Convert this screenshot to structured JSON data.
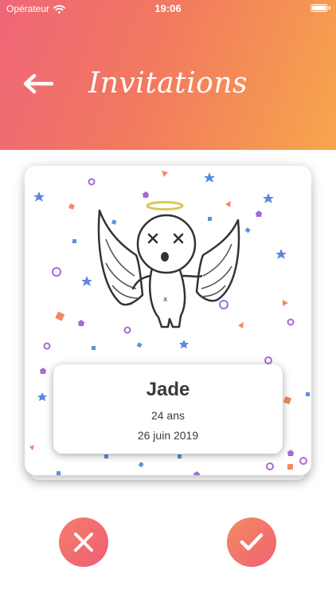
{
  "status_bar": {
    "carrier": "Opérateur",
    "time": "19:06",
    "wifi_icon": "wifi-icon",
    "battery_icon": "battery-icon"
  },
  "header": {
    "title": "Invitations",
    "back_icon": "arrow-left-icon",
    "gradient_colors": [
      "#ef6678",
      "#f6a64c"
    ]
  },
  "card": {
    "illustration": "angel-illustration",
    "name": "Jade",
    "age": "24 ans",
    "date": "26 juin 2019"
  },
  "actions": {
    "decline_icon": "close-icon",
    "accept_icon": "checkmark-icon",
    "button_color": "#f07068"
  }
}
